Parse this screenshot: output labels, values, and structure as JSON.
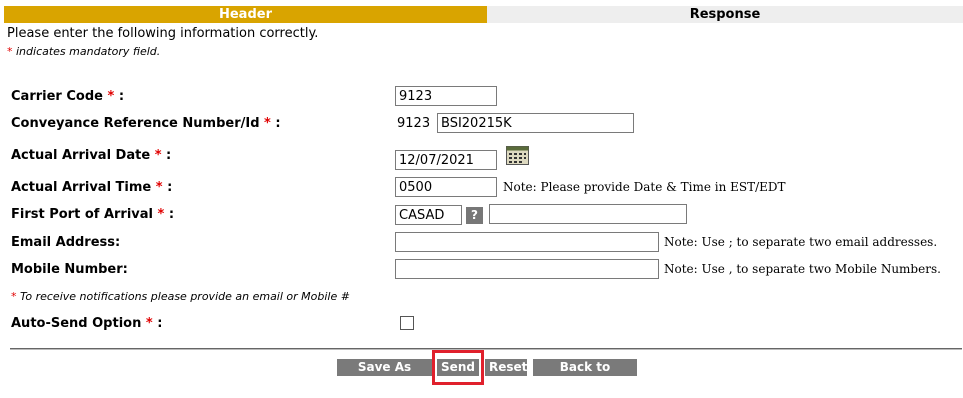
{
  "tabs": {
    "header": "Header",
    "response": "Response"
  },
  "intro": "Please enter the following information correctly.",
  "mandatory_note": {
    "star": "*",
    "text": " indicates mandatory field."
  },
  "form": {
    "carrier_code": {
      "label": "Carrier Code",
      "star": "*",
      "suffix": " :",
      "value": "9123"
    },
    "conveyance": {
      "label": "Conveyance Reference Number/Id",
      "star": "*",
      "suffix": " :",
      "prefix": "9123",
      "value": "BSI20215K"
    },
    "arrival_date": {
      "label": "Actual Arrival Date",
      "star": "*",
      "suffix": " :",
      "value": "12/07/2021"
    },
    "arrival_time": {
      "label": "Actual Arrival Time",
      "star": "*",
      "suffix": " :",
      "value": "0500",
      "note": "Note: Please provide Date & Time in EST/EDT"
    },
    "first_port": {
      "label": "First Port of Arrival",
      "star": "*",
      "suffix": " :",
      "value": "CASAD",
      "help": "?",
      "extra_value": ""
    },
    "email": {
      "label": "Email Address:",
      "value": "",
      "note": "Note: Use ; to separate two email addresses."
    },
    "mobile": {
      "label": "Mobile Number:",
      "value": "",
      "note": "Note: Use , to separate two Mobile Numbers."
    },
    "notify_note": {
      "star": "*",
      "text": " To receive notifications please provide an email or Mobile #"
    },
    "auto_send": {
      "label": "Auto-Send Option",
      "star": "*",
      "suffix": " :",
      "checked": false
    }
  },
  "buttons": {
    "save_draft": "Save As Draft",
    "send": "Send",
    "reset": "Reset",
    "back": "Back to Search"
  },
  "colors": {
    "header_tab": "#d9a400",
    "button": "#7a7a7a",
    "required": "#e00000",
    "highlight": "#e0202c"
  },
  "icons": {
    "calendar": "calendar-icon",
    "help": "help-icon"
  }
}
